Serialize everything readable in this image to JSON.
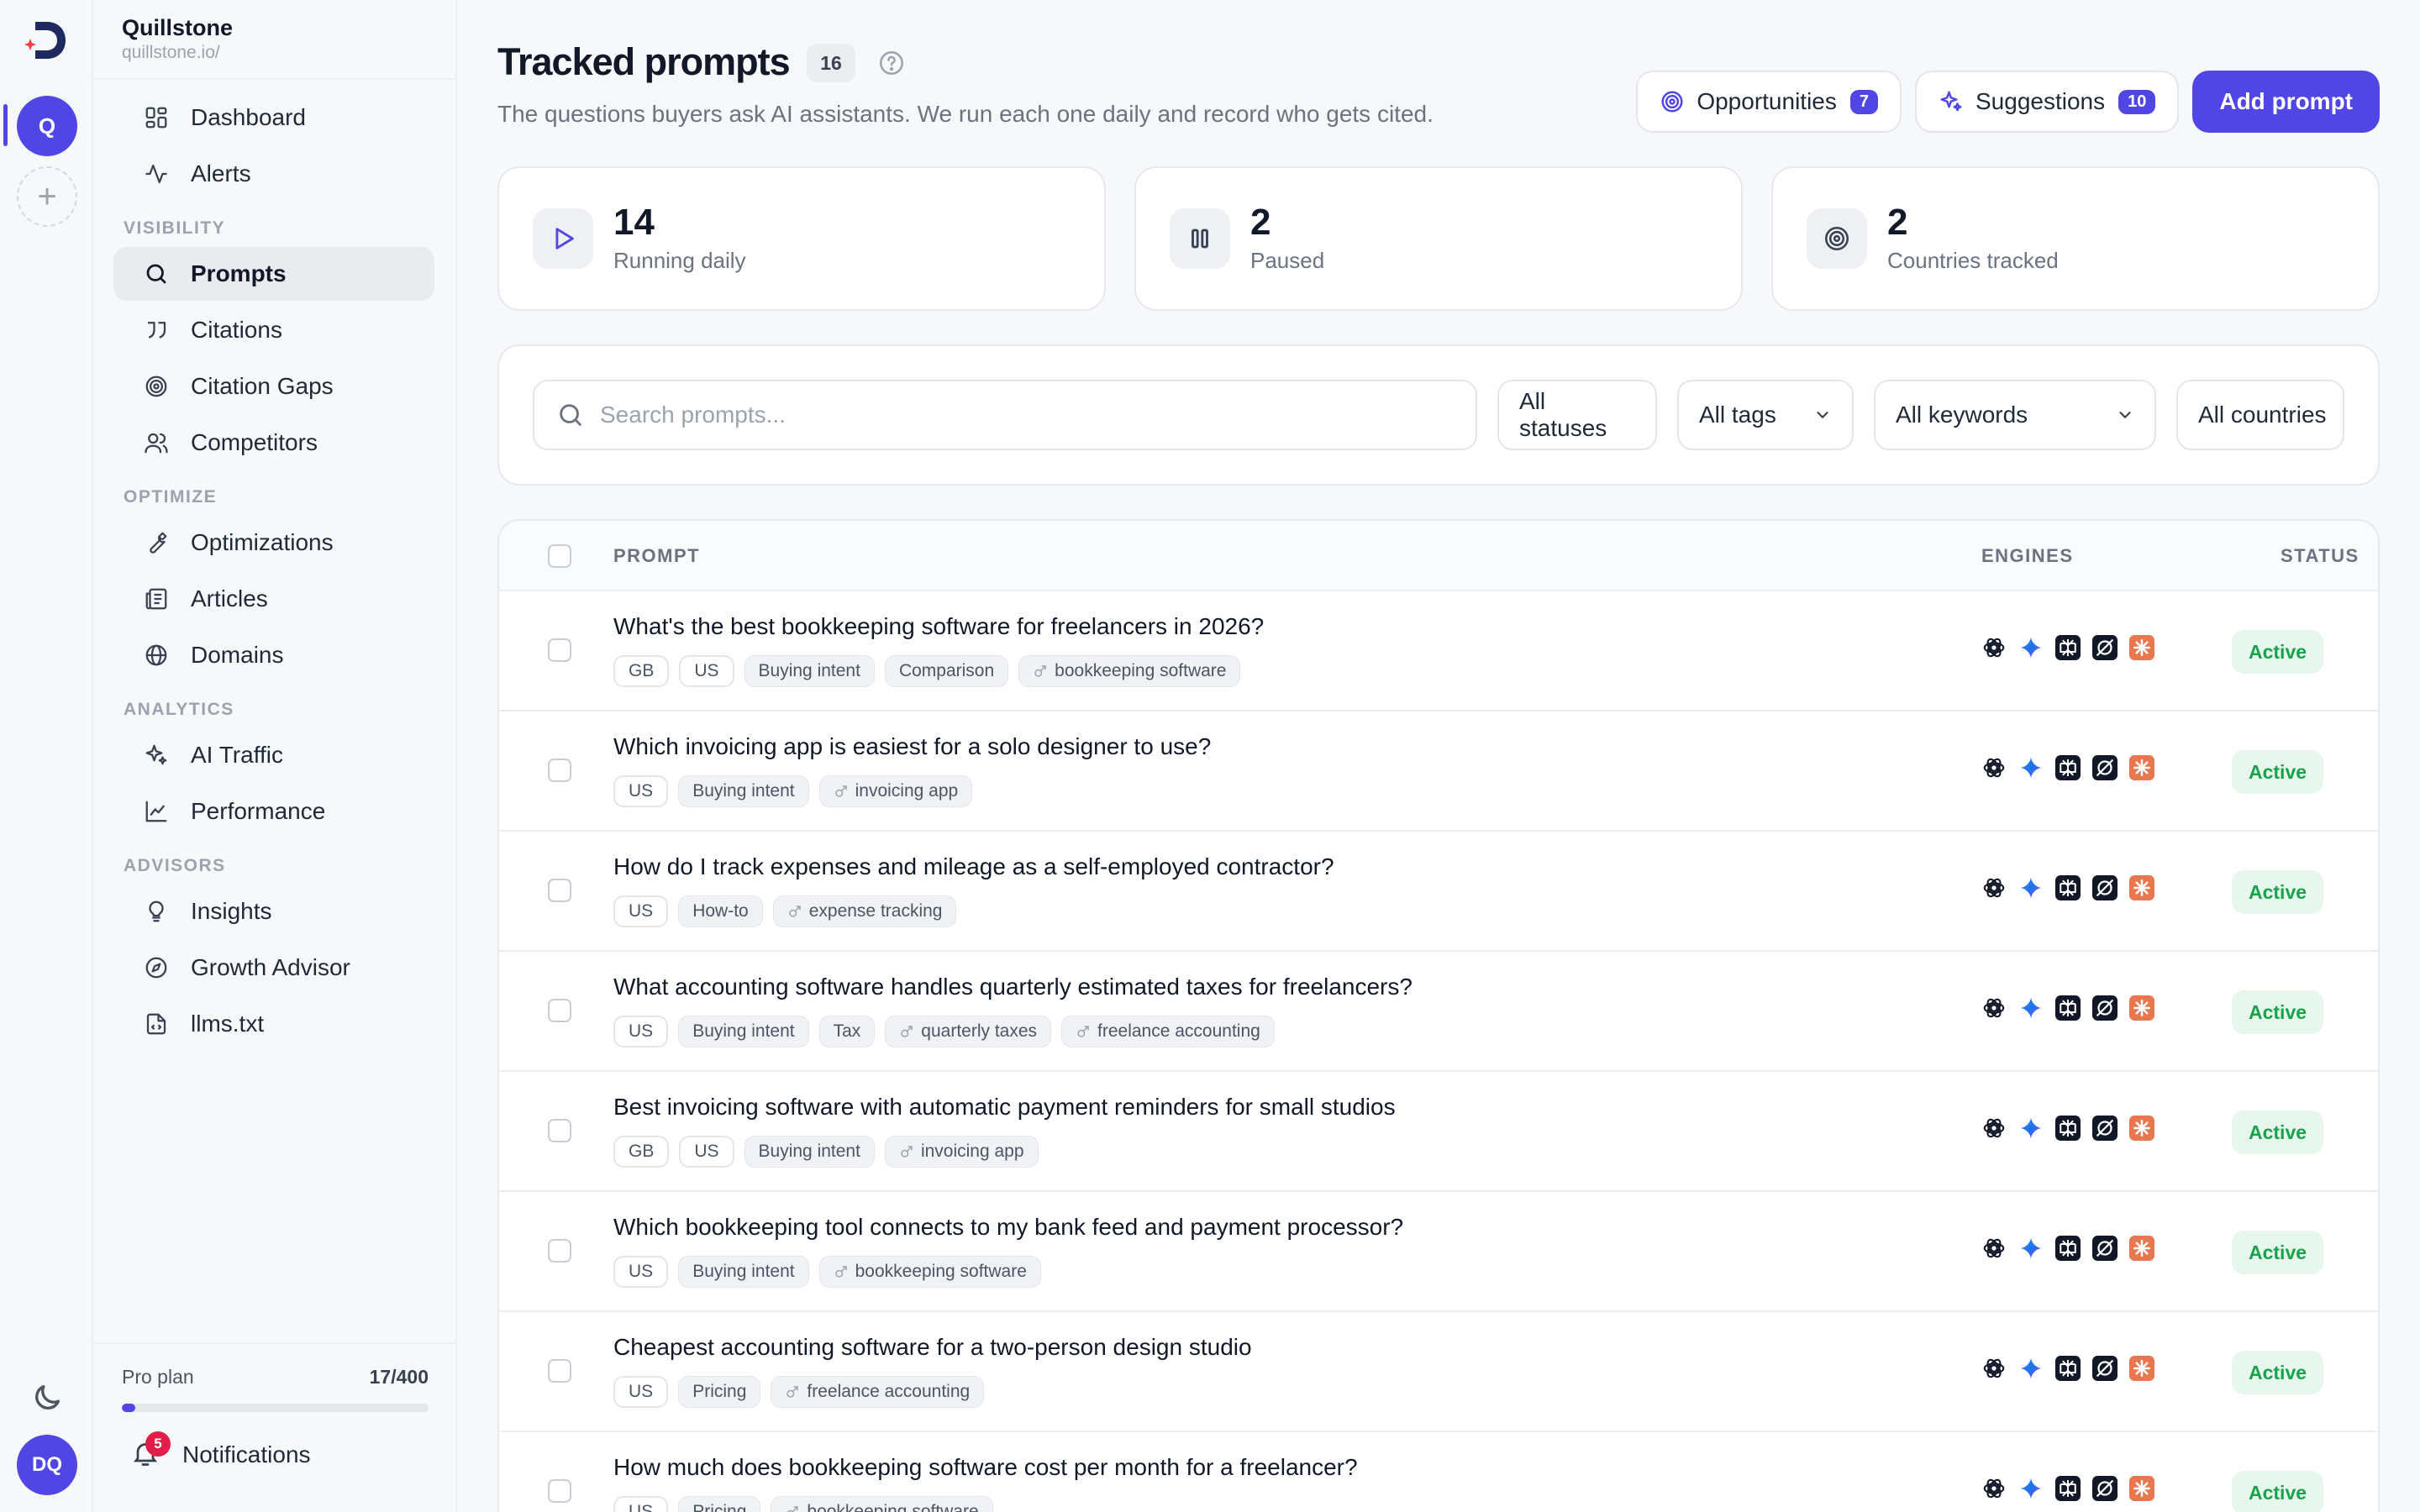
{
  "workspace": {
    "name": "Quillstone",
    "url": "quillstone.io/",
    "initial": "Q"
  },
  "user": {
    "initials": "DQ"
  },
  "nav": {
    "top": [
      {
        "label": "Dashboard",
        "icon": "dashboard-icon"
      },
      {
        "label": "Alerts",
        "icon": "activity-icon"
      }
    ],
    "visibility_title": "VISIBILITY",
    "visibility": [
      {
        "label": "Prompts",
        "icon": "search-icon",
        "active": true
      },
      {
        "label": "Citations",
        "icon": "quote-icon"
      },
      {
        "label": "Citation Gaps",
        "icon": "target-icon"
      },
      {
        "label": "Competitors",
        "icon": "users-icon"
      }
    ],
    "optimize_title": "OPTIMIZE",
    "optimize": [
      {
        "label": "Optimizations",
        "icon": "wrench-icon"
      },
      {
        "label": "Articles",
        "icon": "articles-icon"
      },
      {
        "label": "Domains",
        "icon": "globe-icon"
      }
    ],
    "analytics_title": "ANALYTICS",
    "analytics": [
      {
        "label": "AI Traffic",
        "icon": "sparkles-icon"
      },
      {
        "label": "Performance",
        "icon": "line-chart-icon"
      }
    ],
    "advisors_title": "ADVISORS",
    "advisors": [
      {
        "label": "Insights",
        "icon": "lightbulb-icon"
      },
      {
        "label": "Growth Advisor",
        "icon": "compass-icon"
      },
      {
        "label": "llms.txt",
        "icon": "file-code-icon"
      }
    ]
  },
  "plan": {
    "name": "Pro plan",
    "usage": "17/400",
    "fraction": 0.0425
  },
  "notifications": {
    "label": "Notifications",
    "count": "5"
  },
  "header": {
    "title": "Tracked prompts",
    "count": "16",
    "subtitle": "The questions buyers ask AI assistants. We run each one daily and record who gets cited.",
    "opportunities_label": "Opportunities",
    "opportunities_count": "7",
    "suggestions_label": "Suggestions",
    "suggestions_count": "10",
    "add_label": "Add prompt"
  },
  "stats": [
    {
      "value": "14",
      "label": "Running daily"
    },
    {
      "value": "2",
      "label": "Paused"
    },
    {
      "value": "2",
      "label": "Countries tracked"
    }
  ],
  "filters": {
    "search_placeholder": "Search prompts...",
    "status": "All statuses",
    "tags": "All tags",
    "keywords": "All keywords",
    "countries": "All countries"
  },
  "table": {
    "columns": {
      "prompt": "PROMPT",
      "engines": "ENGINES",
      "status": "STATUS"
    },
    "rows": [
      {
        "prompt": "What's the best bookkeeping software for freelancers in 2026?",
        "countries": [
          "GB",
          "US"
        ],
        "tags": [
          "Buying intent",
          "Comparison"
        ],
        "keywords": [
          "bookkeeping software"
        ],
        "status": "Active"
      },
      {
        "prompt": "Which invoicing app is easiest for a solo designer to use?",
        "countries": [
          "US"
        ],
        "tags": [
          "Buying intent"
        ],
        "keywords": [
          "invoicing app"
        ],
        "status": "Active"
      },
      {
        "prompt": "How do I track expenses and mileage as a self-employed contractor?",
        "countries": [
          "US"
        ],
        "tags": [
          "How-to"
        ],
        "keywords": [
          "expense tracking"
        ],
        "status": "Active"
      },
      {
        "prompt": "What accounting software handles quarterly estimated taxes for freelancers?",
        "countries": [
          "US"
        ],
        "tags": [
          "Buying intent",
          "Tax"
        ],
        "keywords": [
          "quarterly taxes",
          "freelance accounting"
        ],
        "status": "Active"
      },
      {
        "prompt": "Best invoicing software with automatic payment reminders for small studios",
        "countries": [
          "GB",
          "US"
        ],
        "tags": [
          "Buying intent"
        ],
        "keywords": [
          "invoicing app"
        ],
        "status": "Active"
      },
      {
        "prompt": "Which bookkeeping tool connects to my bank feed and payment processor?",
        "countries": [
          "US"
        ],
        "tags": [
          "Buying intent"
        ],
        "keywords": [
          "bookkeeping software"
        ],
        "status": "Active"
      },
      {
        "prompt": "Cheapest accounting software for a two-person design studio",
        "countries": [
          "US"
        ],
        "tags": [
          "Pricing"
        ],
        "keywords": [
          "freelance accounting"
        ],
        "status": "Active"
      },
      {
        "prompt": "How much does bookkeeping software cost per month for a freelancer?",
        "countries": [
          "US"
        ],
        "tags": [
          "Pricing"
        ],
        "keywords": [
          "bookkeeping software"
        ],
        "status": "Active"
      }
    ],
    "engines": [
      "openai-icon",
      "gemini-icon",
      "perplexity-icon",
      "grok-icon",
      "claude-icon"
    ]
  },
  "colors": {
    "accent": "#4f46e5",
    "active_status_bg": "#e8f7ee",
    "active_status_text": "#16a34a",
    "claude": "#e8774f"
  }
}
